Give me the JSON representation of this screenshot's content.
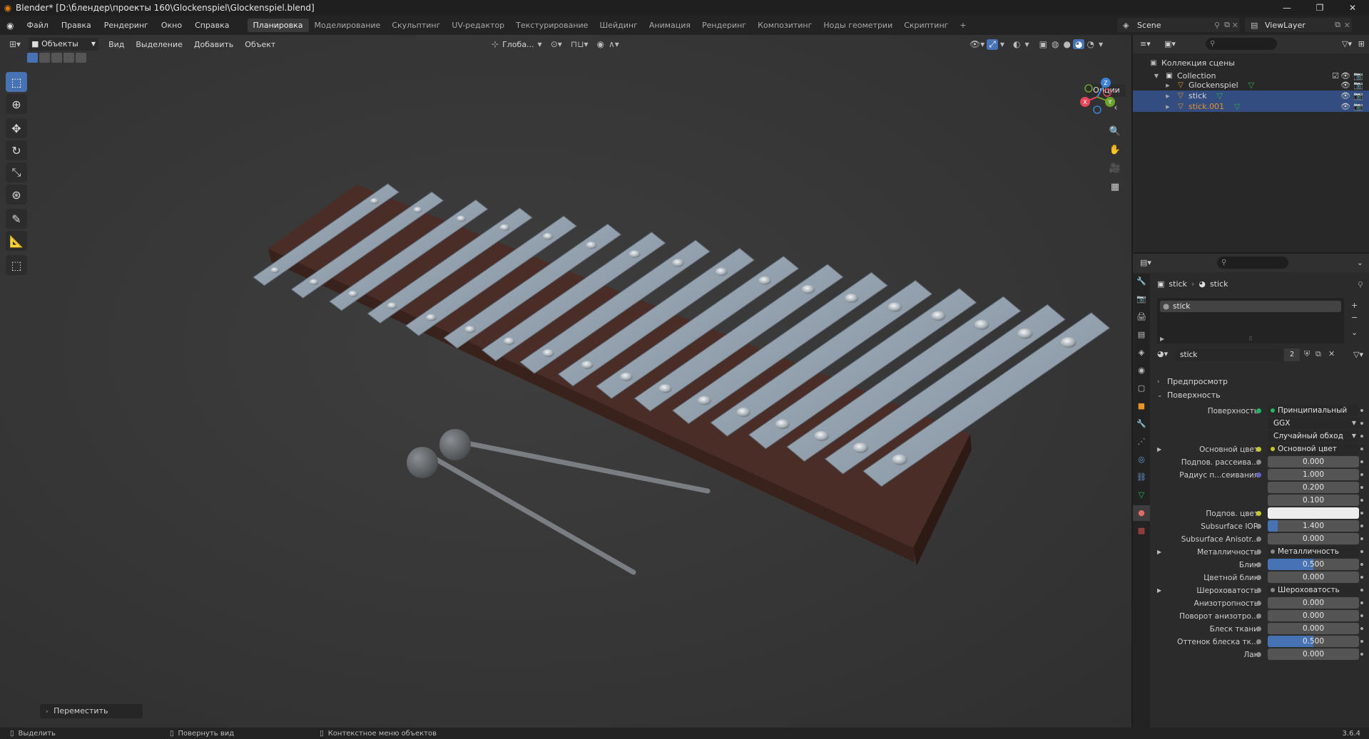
{
  "window": {
    "title": "Blender* [D:\\блендер\\проекты 160\\Glockenspiel\\Glockenspiel.blend]",
    "minimize": "—",
    "maximize": "❐",
    "close": "✕"
  },
  "menu": {
    "items": [
      "Файл",
      "Правка",
      "Рендеринг",
      "Окно",
      "Справка"
    ],
    "workspaces": [
      "Планировка",
      "Моделирование",
      "Скульптинг",
      "UV-редактор",
      "Текстурирование",
      "Шейдинг",
      "Анимация",
      "Рендеринг",
      "Композитинг",
      "Ноды геометрии",
      "Скриптинг"
    ],
    "active_workspace": "Планировка",
    "add_tab": "+",
    "scene": "Scene",
    "view_layer": "ViewLayer"
  },
  "viewport": {
    "mode": "Объекты",
    "menus": [
      "Вид",
      "Выделение",
      "Добавить",
      "Объект"
    ],
    "orientation": "Глоба...",
    "options_label": "Опции",
    "last_operator": "Переместить",
    "gizmo_axes": {
      "x": "X",
      "y": "Y",
      "z": "Z"
    },
    "colors": {
      "x": "#e8465a",
      "y": "#6ea22a",
      "z": "#3d82d6"
    }
  },
  "outliner": {
    "root": "Коллекция сцены",
    "collection": "Collection",
    "objects": [
      {
        "name": "Glockenspiel",
        "selected": false
      },
      {
        "name": "stick",
        "selected": true
      },
      {
        "name": "stick.001",
        "selected": true
      }
    ]
  },
  "properties": {
    "breadcrumb_object": "stick",
    "breadcrumb_material": "stick",
    "slot_name": "stick",
    "material_name": "stick",
    "material_users": "2",
    "sections": {
      "preview": "Предпросмотр",
      "surface": "Поверхность"
    },
    "rows": [
      {
        "label": "Поверхность",
        "value": "Принципиальный BSDF",
        "kind": "link",
        "dot": "green"
      },
      {
        "label": "",
        "value": "GGX",
        "kind": "drop"
      },
      {
        "label": "",
        "value": "Случайный обход",
        "kind": "drop"
      },
      {
        "label": "Основной цвет",
        "value": "Основной цвет",
        "kind": "link",
        "dot": "yellow",
        "expand": true
      },
      {
        "label": "Подпов. рассеива...",
        "value": "0.000",
        "kind": "num",
        "dot": "gray"
      },
      {
        "label": "Радиус п...сеивания",
        "value": "1.000",
        "kind": "num",
        "dot": "blue"
      },
      {
        "label": "",
        "value": "0.200",
        "kind": "num"
      },
      {
        "label": "",
        "value": "0.100",
        "kind": "num"
      },
      {
        "label": "Подпов. цвет",
        "value": "",
        "kind": "white",
        "dot": "yellow"
      },
      {
        "label": "Subsurface IOR",
        "value": "1.400",
        "kind": "blue",
        "fill": 0.11,
        "dot": "gray"
      },
      {
        "label": "Subsurface Anisotr...",
        "value": "0.000",
        "kind": "num",
        "dot": "gray"
      },
      {
        "label": "Металличность",
        "value": "Металличность",
        "kind": "link",
        "dot": "gray",
        "expand": true
      },
      {
        "label": "Блик",
        "value": "0.500",
        "kind": "blue",
        "fill": 0.5,
        "dot": "gray"
      },
      {
        "label": "Цветной блик",
        "value": "0.000",
        "kind": "num",
        "dot": "gray"
      },
      {
        "label": "Шероховатость",
        "value": "Шероховатость",
        "kind": "link",
        "dot": "gray",
        "expand": true
      },
      {
        "label": "Анизотропность",
        "value": "0.000",
        "kind": "num",
        "dot": "gray"
      },
      {
        "label": "Поворот анизотро...",
        "value": "0.000",
        "kind": "num",
        "dot": "gray"
      },
      {
        "label": "Блеск ткани",
        "value": "0.000",
        "kind": "num",
        "dot": "gray"
      },
      {
        "label": "Оттенок блеска тк...",
        "value": "0.500",
        "kind": "blue",
        "fill": 0.5,
        "dot": "gray"
      },
      {
        "label": "Лак",
        "value": "0.000",
        "kind": "num",
        "dot": "gray"
      }
    ]
  },
  "statusbar": {
    "select": "Выделить",
    "rotate": "Повернуть вид",
    "context": "Контекстное меню объектов",
    "version": "3.6.4"
  }
}
